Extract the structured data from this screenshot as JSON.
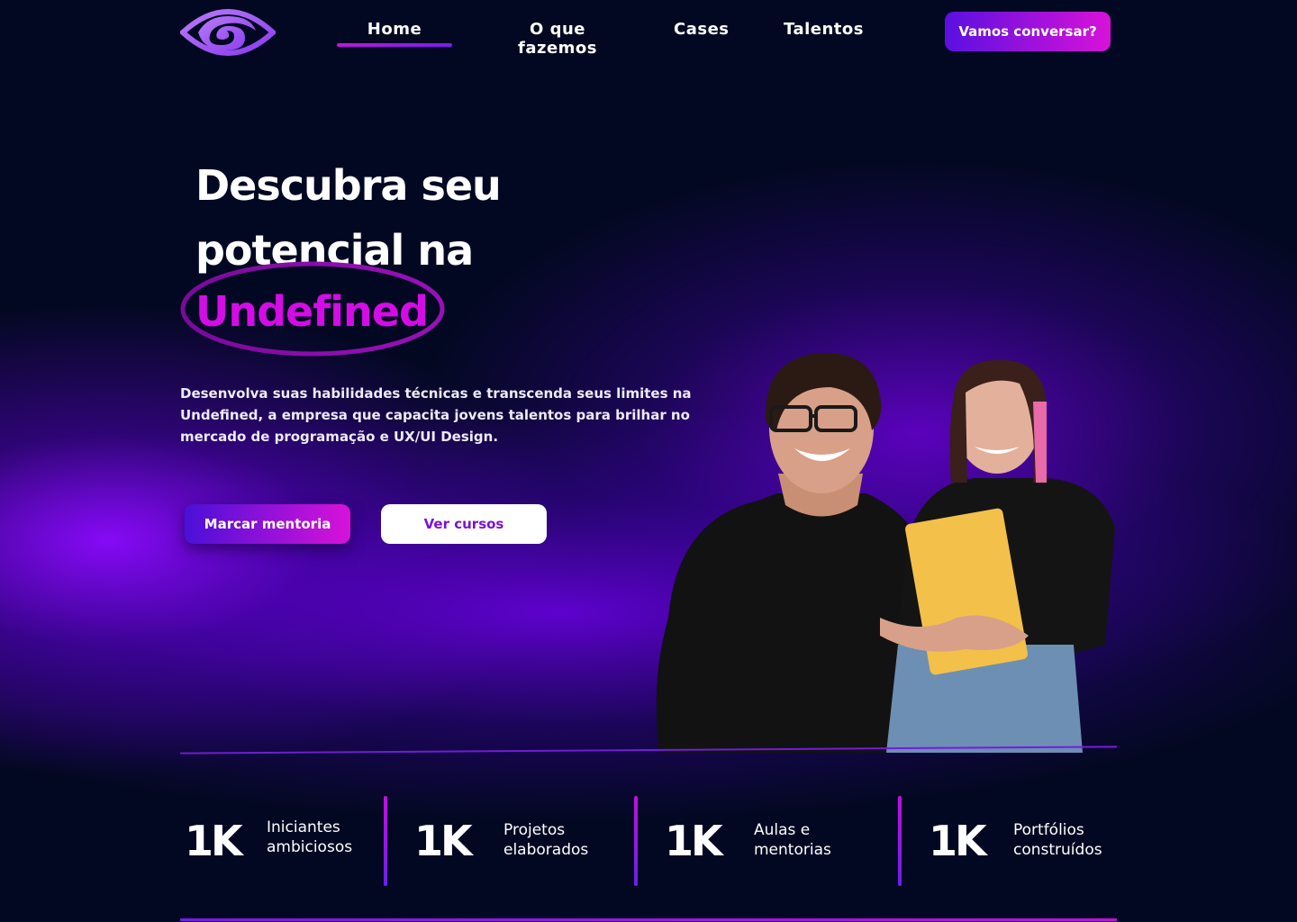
{
  "nav": {
    "links": [
      {
        "label": "Home",
        "active": true
      },
      {
        "label": "O que fazemos",
        "active": false
      },
      {
        "label": "Cases",
        "active": false
      },
      {
        "label": "Talentos",
        "active": false
      }
    ],
    "cta_label": "Vamos conversar?"
  },
  "hero": {
    "title_line1": "Descubra seu",
    "title_line2": "potencial na",
    "title_accent": "Undefined",
    "description": "Desenvolva suas habilidades técnicas e transcenda seus limites na Undefined, a empresa que capacita jovens talentos para brilhar no mercado de programação e UX/UI Design.",
    "primary_button": "Marcar mentoria",
    "secondary_button": "Ver cursos"
  },
  "stats": [
    {
      "number": "1K",
      "label_line1": "Iniciantes",
      "label_line2": "ambiciosos"
    },
    {
      "number": "1K",
      "label_line1": "Projetos",
      "label_line2": "elaborados"
    },
    {
      "number": "1K",
      "label_line1": "Aulas e",
      "label_line2": "mentorias"
    },
    {
      "number": "1K",
      "label_line1": "Portfólios",
      "label_line2": "construídos"
    }
  ],
  "colors": {
    "background": "#030822",
    "accent_magenta": "#d40ce6",
    "accent_purple": "#7b1cf0",
    "button_secondary_text": "#7a12d8"
  },
  "icons": {
    "logo": "eye-swirl-logo-icon",
    "hero_image": "two-students-photo"
  }
}
